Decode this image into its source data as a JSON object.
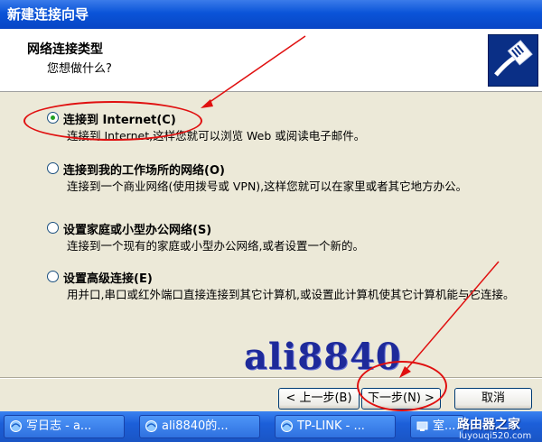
{
  "window": {
    "title": "新建连接向导"
  },
  "header": {
    "title": "网络连接类型",
    "subtitle": "您想做什么?"
  },
  "options": [
    {
      "label": "连接到 Internet(C)",
      "desc": "连接到 Internet,这样您就可以浏览 Web 或阅读电子邮件。",
      "checked": true
    },
    {
      "label": "连接到我的工作场所的网络(O)",
      "desc": "连接到一个商业网络(使用拨号或 VPN),这样您就可以在家里或者其它地方办公。",
      "checked": false
    },
    {
      "label": "设置家庭或小型办公网络(S)",
      "desc": "连接到一个现有的家庭或小型办公网络,或者设置一个新的。",
      "checked": false
    },
    {
      "label": "设置高级连接(E)",
      "desc": "用并口,串口或红外端口直接连接到其它计算机,或设置此计算机使其它计算机能与它连接。",
      "checked": false
    }
  ],
  "buttons": {
    "back": "< 上一步(B)",
    "next": "下一步(N) >",
    "cancel": "取消"
  },
  "watermark": "ali8840",
  "taskbar": {
    "items": [
      {
        "label": "写日志 - a..."
      },
      {
        "label": "ali8840的..."
      },
      {
        "label": "TP-LINK - ..."
      },
      {
        "label": "室..."
      }
    ]
  },
  "brand": {
    "line1": "路由器之家",
    "line2": "luyouqi520.com"
  },
  "colors": {
    "title_bar": "#0a54d8",
    "annotation": "#e01010",
    "taskbar": "#1c5fd9"
  }
}
